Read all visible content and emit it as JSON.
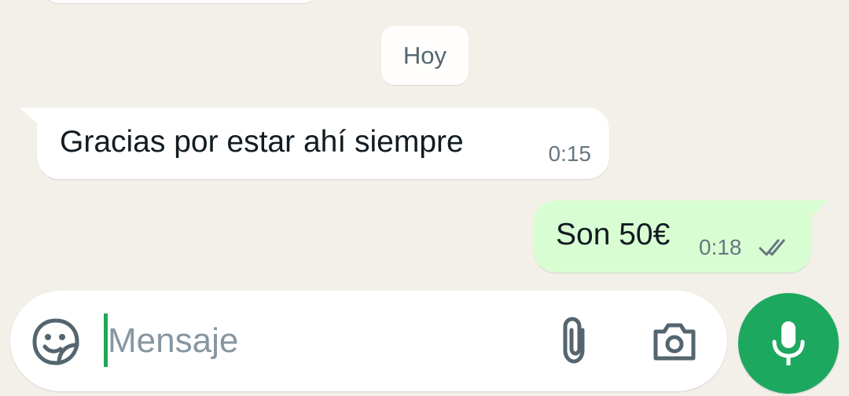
{
  "date_chip": {
    "label": "Hoy"
  },
  "messages": [
    {
      "direction": "incoming",
      "text": "Gracias por estar ahí siempre",
      "time": "0:15"
    },
    {
      "direction": "outgoing",
      "text": "Son 50€",
      "time": "0:18",
      "status": "double-check-read"
    }
  ],
  "composer": {
    "placeholder": "Mensaje",
    "value": "",
    "icons": {
      "sticker": "sticker-icon",
      "attach": "paperclip-icon",
      "camera": "camera-icon",
      "send": "microphone-icon"
    }
  },
  "colors": {
    "background": "#f3f0ea",
    "incoming_bubble": "#ffffff",
    "outgoing_bubble": "#d9fdd3",
    "accent": "#1da860",
    "meta_text": "#667781"
  }
}
